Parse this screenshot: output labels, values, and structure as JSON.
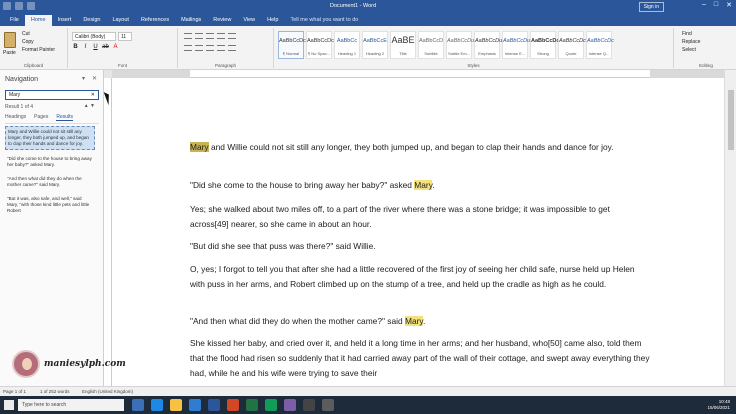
{
  "window": {
    "title": "Document1 - Word",
    "sign_in": "Sign in"
  },
  "ribbon_tabs": [
    "File",
    "Home",
    "Insert",
    "Design",
    "Layout",
    "References",
    "Mailings",
    "Review",
    "View",
    "Help",
    "Tell me what you want to do"
  ],
  "ribbon": {
    "clipboard": {
      "paste": "Paste",
      "cut": "Cut",
      "copy": "Copy",
      "format_painter": "Format Painter",
      "label": "Clipboard"
    },
    "font": {
      "name": "Calibri (Body)",
      "size": "11",
      "label": "Font"
    },
    "paragraph": {
      "label": "Paragraph"
    },
    "styles": {
      "label": "Styles",
      "items": [
        {
          "sample": "AaBbCcDc",
          "name": "¶ Normal"
        },
        {
          "sample": "AaBbCcDc",
          "name": "¶ No Spac..."
        },
        {
          "sample": "AaBbCc",
          "name": "Heading 1"
        },
        {
          "sample": "AaBbCcE",
          "name": "Heading 2"
        },
        {
          "sample": "AaBE",
          "name": "Title"
        },
        {
          "sample": "AaBbCcD",
          "name": "Subtitle"
        },
        {
          "sample": "AaBbCcDu",
          "name": "Subtle Em..."
        },
        {
          "sample": "AaBbCcDu",
          "name": "Emphasis"
        },
        {
          "sample": "AaBbCcDu",
          "name": "Intense E..."
        },
        {
          "sample": "AaBbCcDc",
          "name": "Strong"
        },
        {
          "sample": "AaBbCcDc",
          "name": "Quote"
        },
        {
          "sample": "AaBbCcDc",
          "name": "Intense Q..."
        }
      ]
    },
    "editing": {
      "find": "Find",
      "replace": "Replace",
      "select": "Select",
      "label": "Editing"
    }
  },
  "navigation": {
    "title": "Navigation",
    "search_value": "Mary",
    "result_count": "Result 1 of 4",
    "tabs": [
      "Headings",
      "Pages",
      "Results"
    ],
    "results": [
      "Mary and Willie could not sit still any longer, they both jumped up, and began to clap their hands and dance for joy.",
      "\"Did she come to the house to bring away her baby?\" asked Mary.",
      "\"And then what did they do when the mother came?\" said Mary.",
      "\"But it was, also safe, and well,\" said Mary, \"with those kind little pets and little Robert"
    ]
  },
  "document": {
    "paragraphs": [
      {
        "before": "",
        "hl": "Mary",
        "after": " and Willie could not sit still any longer, they both jumped up, and began to clap their hands and dance for joy."
      },
      {
        "before": "\"Did she come to the house to bring away her baby?\" asked ",
        "hl": "Mary",
        "after": "."
      },
      {
        "before": "Yes; she walked about two miles off, to a part of the river where there was a stone bridge; it was impossible to get across[49] nearer, so she came in about an hour.",
        "hl": "",
        "after": ""
      },
      {
        "before": "\"But did she see that puss was there?\" said Willie.",
        "hl": "",
        "after": ""
      },
      {
        "before": "O, yes; I forgot to tell you that after she had a little recovered of the first joy of seeing her child safe, nurse held up Helen with puss in her arms, and Robert climbed up on the stump of a tree, and held up the cradle as high as he could.",
        "hl": "",
        "after": ""
      },
      {
        "before": "\"And then what did they do when the mother came?\" said ",
        "hl": "Mary",
        "after": "."
      },
      {
        "before": "She kissed her baby, and cried over it, and held it a long time in her arms; and her husband, who[50] came also, told them that the flood had risen so suddenly that it had carried away part of the wall of their cottage, and swept away everything they had, while he and his wife were trying to save their",
        "hl": "",
        "after": ""
      }
    ]
  },
  "status": {
    "page": "Page 1 of 1",
    "words": "1 of 252 words",
    "language": "English (United Kingdom)"
  },
  "taskbar": {
    "search_placeholder": "Type here to search",
    "time": "10:48",
    "date": "15/06/2021"
  },
  "watermark": {
    "text": "maniesylph.com"
  },
  "colors": {
    "ribbon_blue": "#2b579a",
    "highlight": "#f3e27a",
    "current_highlight": "#c9b450"
  }
}
